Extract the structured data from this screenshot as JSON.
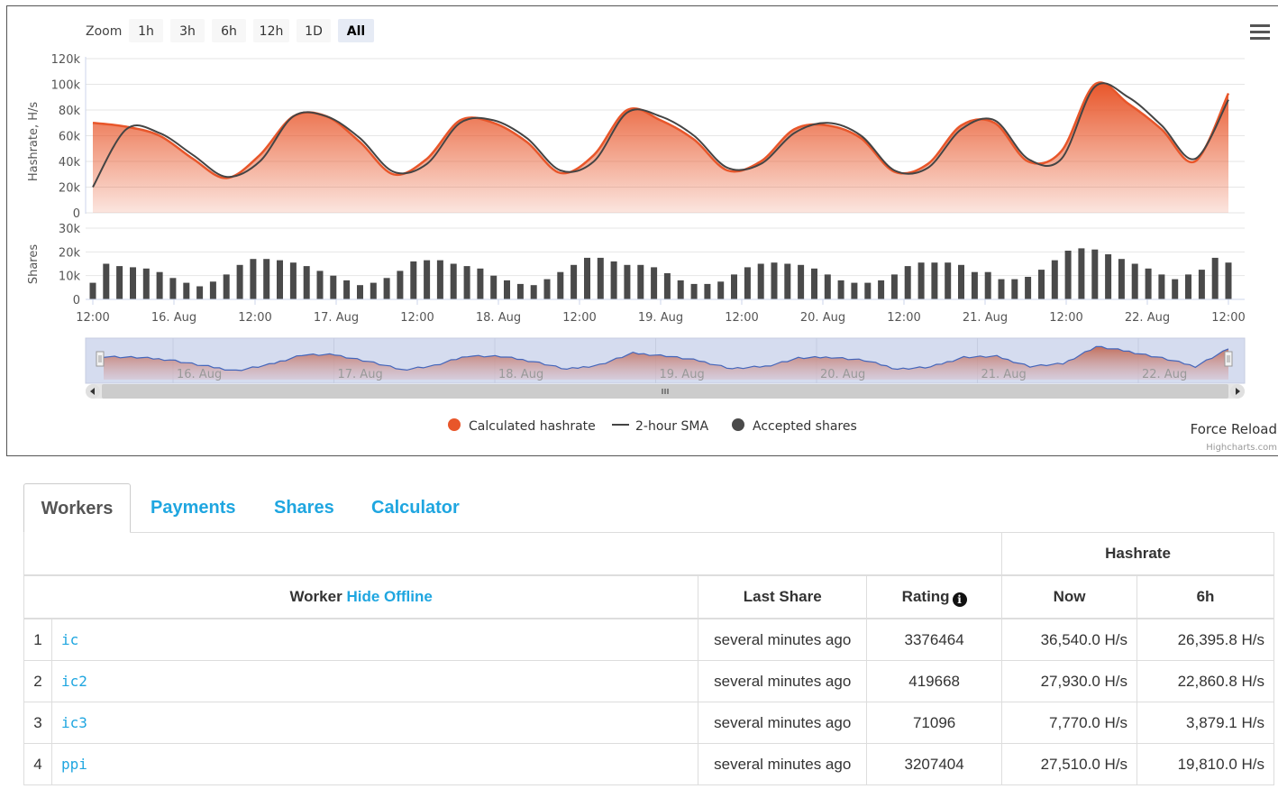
{
  "zoom": {
    "label": "Zoom",
    "buttons": [
      "1h",
      "3h",
      "6h",
      "12h",
      "1D",
      "All"
    ],
    "selected": "All"
  },
  "menu": {
    "icon": "hamburger-icon"
  },
  "colors": {
    "hashrate": "#e8562a",
    "sma": "#444444",
    "shares": "#4a4a4a",
    "navigator_line": "#4466bb",
    "accent": "#1fa6e0"
  },
  "axes": {
    "hashrate_title": "Hashrate, H/s",
    "hashrate_ticks": [
      "120k",
      "100k",
      "80k",
      "60k",
      "40k",
      "20k",
      "0"
    ],
    "shares_title": "Shares",
    "shares_ticks": [
      "30k",
      "20k",
      "10k",
      "0"
    ],
    "x_ticks": [
      "12:00",
      "16. Aug",
      "12:00",
      "17. Aug",
      "12:00",
      "18. Aug",
      "12:00",
      "19. Aug",
      "12:00",
      "20. Aug",
      "12:00",
      "21. Aug",
      "12:00",
      "22. Aug",
      "12:00"
    ],
    "navigator_ticks": [
      "16. Aug",
      "17. Aug",
      "18. Aug",
      "19. Aug",
      "20. Aug",
      "21. Aug",
      "22. Aug"
    ]
  },
  "legend": {
    "hashrate": "Calculated hashrate",
    "sma": "2-hour SMA",
    "shares": "Accepted shares"
  },
  "force_reload": "Force Reload",
  "credits": "Highcharts.com",
  "chart_data": {
    "type": "area",
    "x_start": "15. Aug 12:00",
    "x_end": "22. Aug 12:00",
    "y_range": [
      0,
      120000
    ],
    "hashrate": [
      70000,
      67000,
      60000,
      42000,
      27000,
      45000,
      75000,
      75000,
      55000,
      30000,
      42000,
      72000,
      70000,
      55000,
      31000,
      45000,
      80000,
      72000,
      57000,
      33000,
      40000,
      65000,
      68000,
      58000,
      32000,
      38000,
      68000,
      70000,
      40000,
      48000,
      100000,
      85000,
      65000,
      40000,
      93000
    ],
    "sma": [
      20000,
      65000,
      62000,
      45000,
      28000,
      40000,
      75000,
      75000,
      58000,
      32000,
      38000,
      70000,
      72000,
      58000,
      33000,
      40000,
      78000,
      75000,
      60000,
      35000,
      38000,
      62000,
      70000,
      60000,
      33000,
      35000,
      65000,
      72000,
      42000,
      42000,
      98000,
      90000,
      68000,
      42000,
      88000
    ],
    "shares_range": [
      0,
      30000
    ],
    "shares": [
      7000,
      15000,
      14000,
      13500,
      13000,
      11500,
      9000,
      7000,
      5500,
      7500,
      10500,
      14500,
      17000,
      17000,
      16500,
      15500,
      14000,
      12000,
      10000,
      8000,
      6000,
      7000,
      9000,
      12000,
      16000,
      16500,
      16500,
      15000,
      14000,
      13000,
      10000,
      8000,
      6500,
      6000,
      8500,
      11500,
      14500,
      17500,
      17500,
      16000,
      14500,
      14500,
      13500,
      11000,
      8000,
      6500,
      6500,
      7500,
      10500,
      13500,
      15000,
      15500,
      15000,
      14500,
      13000,
      10500,
      8000,
      7000,
      7000,
      8000,
      10500,
      14000,
      15500,
      15500,
      15500,
      14500,
      11500,
      11500,
      8500,
      8500,
      9500,
      12500,
      16500,
      20500,
      21500,
      21000,
      19000,
      17000,
      15000,
      13000,
      10500,
      8500,
      10500,
      12500,
      17500,
      15500
    ]
  },
  "tabs": [
    "Workers",
    "Payments",
    "Shares",
    "Calculator"
  ],
  "table": {
    "group_header": "Hashrate",
    "headers": {
      "worker": "Worker",
      "hide_offline": "Hide Offline",
      "last_share": "Last Share",
      "rating": "Rating",
      "now": "Now",
      "h6": "6h"
    },
    "rows": [
      {
        "n": "1",
        "name": "ic",
        "last": "several minutes ago",
        "rating": "3376464",
        "now": "36,540.0 H/s",
        "h6": "26,395.8 H/s"
      },
      {
        "n": "2",
        "name": "ic2",
        "last": "several minutes ago",
        "rating": "419668",
        "now": "27,930.0 H/s",
        "h6": "22,860.8 H/s"
      },
      {
        "n": "3",
        "name": "ic3",
        "last": "several minutes ago",
        "rating": "71096",
        "now": "7,770.0 H/s",
        "h6": "3,879.1 H/s"
      },
      {
        "n": "4",
        "name": "ppi",
        "last": "several minutes ago",
        "rating": "3207404",
        "now": "27,510.0 H/s",
        "h6": "19,810.0 H/s"
      }
    ]
  }
}
